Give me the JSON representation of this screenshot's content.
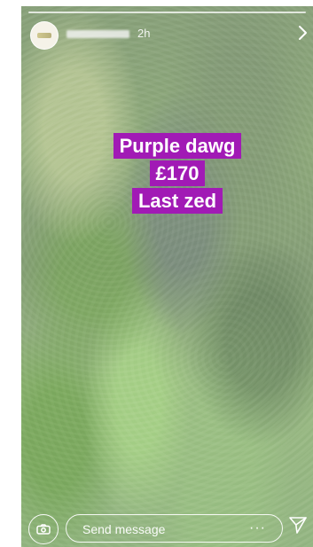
{
  "story": {
    "username": "",
    "timestamp": "2h",
    "caption_lines": [
      "Purple dawg",
      "£170",
      "Last zed"
    ]
  },
  "message": {
    "placeholder": "Send message",
    "more": "···"
  },
  "icons": {
    "next": "chevron-right-icon",
    "camera": "camera-icon",
    "more": "more-icon",
    "send": "send-icon"
  },
  "colors": {
    "caption_bg": "#a11ab5",
    "text": "#ffffff"
  }
}
